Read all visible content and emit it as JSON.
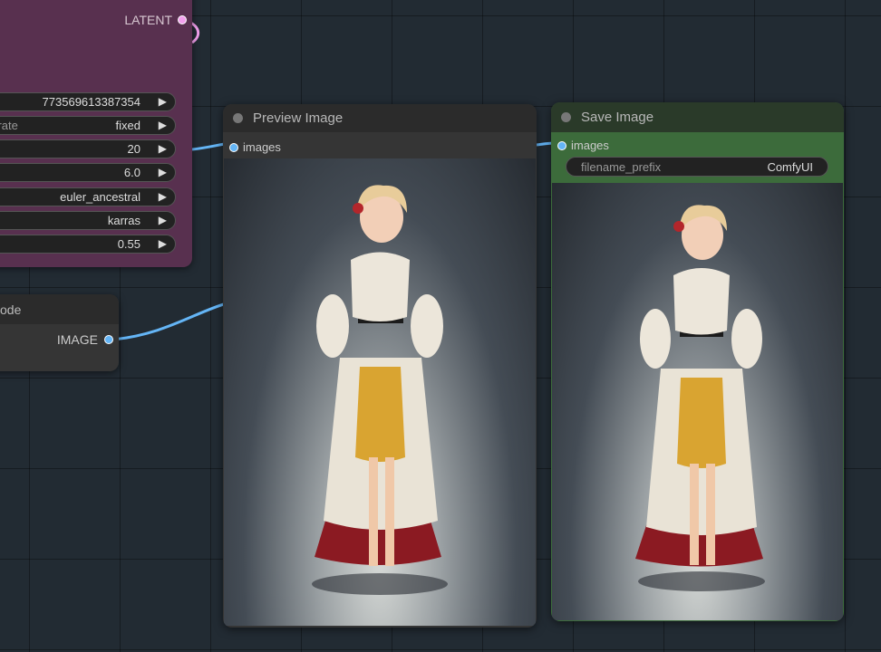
{
  "ksampler": {
    "output": {
      "label": "LATENT"
    },
    "widgets": [
      {
        "label": "",
        "value": "773569613387354"
      },
      {
        "label": "nerate",
        "value": "fixed"
      },
      {
        "label": "",
        "value": "20"
      },
      {
        "label": "",
        "value": "6.0"
      },
      {
        "label": "",
        "value": "euler_ancestral"
      },
      {
        "label": "",
        "value": "karras"
      },
      {
        "label": "",
        "value": "0.55"
      }
    ]
  },
  "decode_node": {
    "title": "ode",
    "output": {
      "label": "IMAGE"
    }
  },
  "preview_node": {
    "title": "Preview Image",
    "input": {
      "label": "images"
    }
  },
  "save_node": {
    "title": "Save Image",
    "input": {
      "label": "images"
    },
    "widget": {
      "label": "filename_prefix",
      "value": "ComfyUI"
    }
  },
  "colors": {
    "canvas": "#222b33",
    "ksampler": "#58304f",
    "save_node": "#3c6b3b",
    "image_link": "#64b5f6",
    "latent_link": "#f3a0ee"
  }
}
